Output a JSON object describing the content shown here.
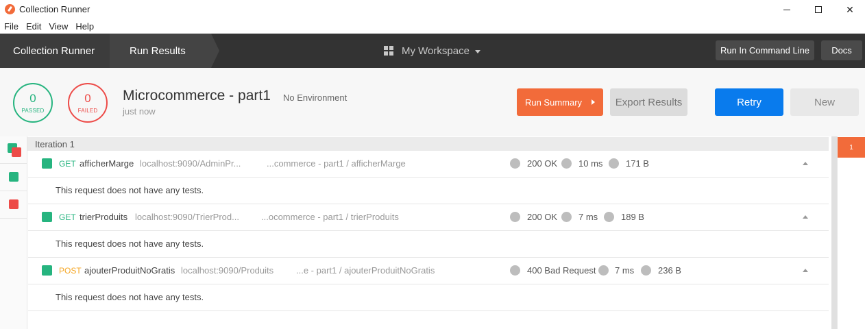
{
  "window": {
    "title": "Collection Runner",
    "minimize_icon": "minimize-icon",
    "maximize_icon": "maximize-icon",
    "close_icon": "close-icon",
    "close_glyph": "✕"
  },
  "menu": [
    "File",
    "Edit",
    "View",
    "Help"
  ],
  "toolbar": {
    "crumb_runner": "Collection Runner",
    "crumb_results": "Run Results",
    "workspace": "My Workspace",
    "cmd_button": "Run In Command Line",
    "docs_button": "Docs"
  },
  "summary": {
    "passed_count": "0",
    "passed_label": "PASSED",
    "failed_count": "0",
    "failed_label": "FAILED",
    "collection_name": "Microcommerce - part1",
    "environment": "No Environment",
    "time": "just now",
    "run_summary_button": "Run Summary",
    "export_button": "Export Results",
    "retry_button": "Retry",
    "new_button": "New"
  },
  "iteration": {
    "label": "Iteration 1",
    "badge": "1"
  },
  "requests": [
    {
      "method": "GET",
      "name": "afficherMarge",
      "url": "localhost:9090/AdminPr...",
      "path": "...commerce - part1 / afficherMarge",
      "status": "200 OK",
      "time": "10 ms",
      "size": "171 B",
      "tests_message": "This request does not have any tests."
    },
    {
      "method": "GET",
      "name": "trierProduits",
      "url": "localhost:9090/TrierProd...",
      "path": "...ocommerce - part1 / trierProduits",
      "status": "200 OK",
      "time": "7 ms",
      "size": "189 B",
      "tests_message": "This request does not have any tests."
    },
    {
      "method": "POST",
      "name": "ajouterProduitNoGratis",
      "url": "localhost:9090/Produits",
      "path": "...e - part1 / ajouterProduitNoGratis",
      "status": "400 Bad Request",
      "time": "7 ms",
      "size": "236 B",
      "tests_message": "This request does not have any tests."
    }
  ],
  "colors": {
    "pass": "#26b47f",
    "fail": "#ed4b48",
    "accent": "#f26b3a",
    "primary": "#097bed",
    "post": "#f5a623"
  }
}
